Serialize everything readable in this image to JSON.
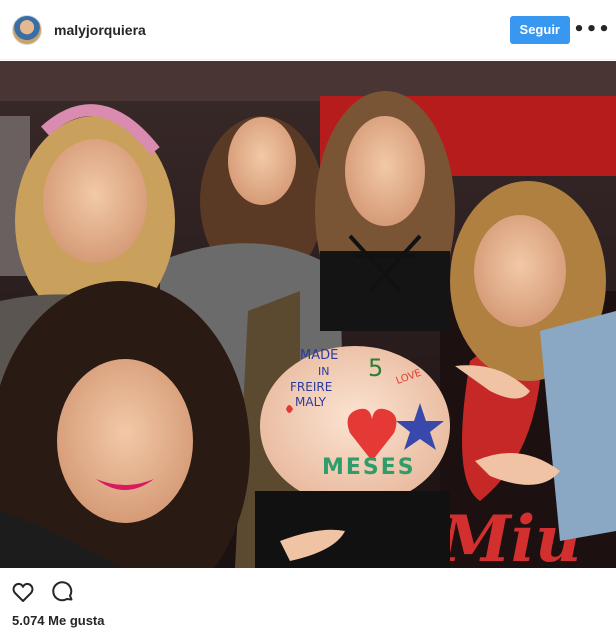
{
  "header": {
    "username": "malyjorquiera",
    "follow_label": "Seguir",
    "more_label": "•••",
    "avatar_icon": "profile-avatar"
  },
  "post": {
    "image_icon": "group-selfie-photo",
    "belly_text": {
      "line1": "MADE",
      "line2": "IN",
      "line3": "FREIRE",
      "line4": "MALY",
      "number": "5",
      "number_tag": "LOVE",
      "bottom": "MESES"
    },
    "background_text": "Miu"
  },
  "actions": {
    "like_icon": "heart-icon",
    "comment_icon": "comment-bubble-icon"
  },
  "likes": {
    "text": "5.074 Me gusta"
  },
  "colors": {
    "follow_button": "#3897f0",
    "text": "#262626",
    "border": "#efefef"
  }
}
